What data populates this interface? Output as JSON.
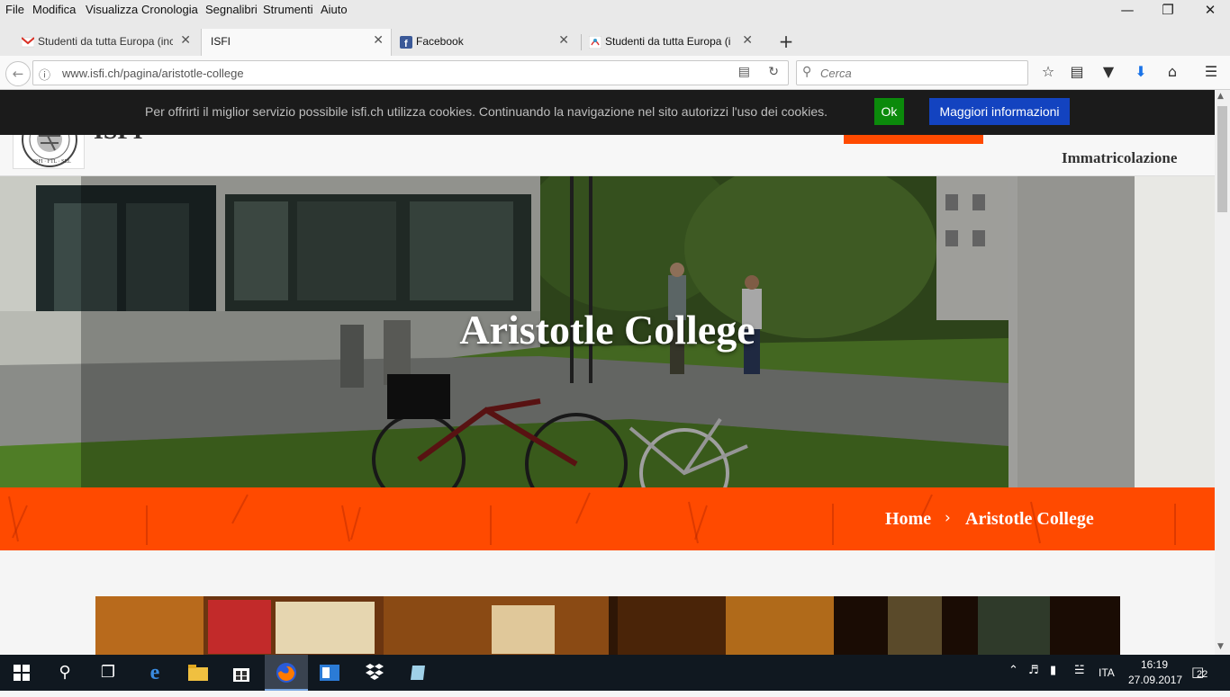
{
  "menubar": {
    "items": [
      "File",
      "Modifica",
      "Visualizza",
      "Cronologia",
      "Segnalibri",
      "Strumenti",
      "Aiuto"
    ]
  },
  "tabs": [
    {
      "label": "Studenti da tutta Europa (inc",
      "icon": "gmail-icon",
      "active": false
    },
    {
      "label": "ISFI",
      "icon": "none",
      "active": true
    },
    {
      "label": "Facebook",
      "icon": "facebook-icon",
      "active": false
    },
    {
      "label": "Studenti da tutta Europa (inc",
      "icon": "site-icon",
      "active": false
    }
  ],
  "navbar": {
    "url": "www.isfi.ch/pagina/aristotle-college",
    "search_placeholder": "Cerca"
  },
  "site": {
    "name": "ISFI",
    "nav_item": "Immatricolazione",
    "accent_color": "#ff4a00"
  },
  "cookie": {
    "message": "Per offrirti il miglior servizio possibile isfi.ch utilizza cookies. Continuando la navigazione nel sito autorizzi l'uso dei cookies.",
    "ok_label": "Ok",
    "more_label": "Maggiori informazioni"
  },
  "hero": {
    "title": "Aristotle College"
  },
  "breadcrumb": {
    "home": "Home",
    "current": "Aristotle College"
  },
  "taskbar": {
    "language": "ITA",
    "time": "16:19",
    "date": "27.09.2017",
    "notifications": "22"
  }
}
